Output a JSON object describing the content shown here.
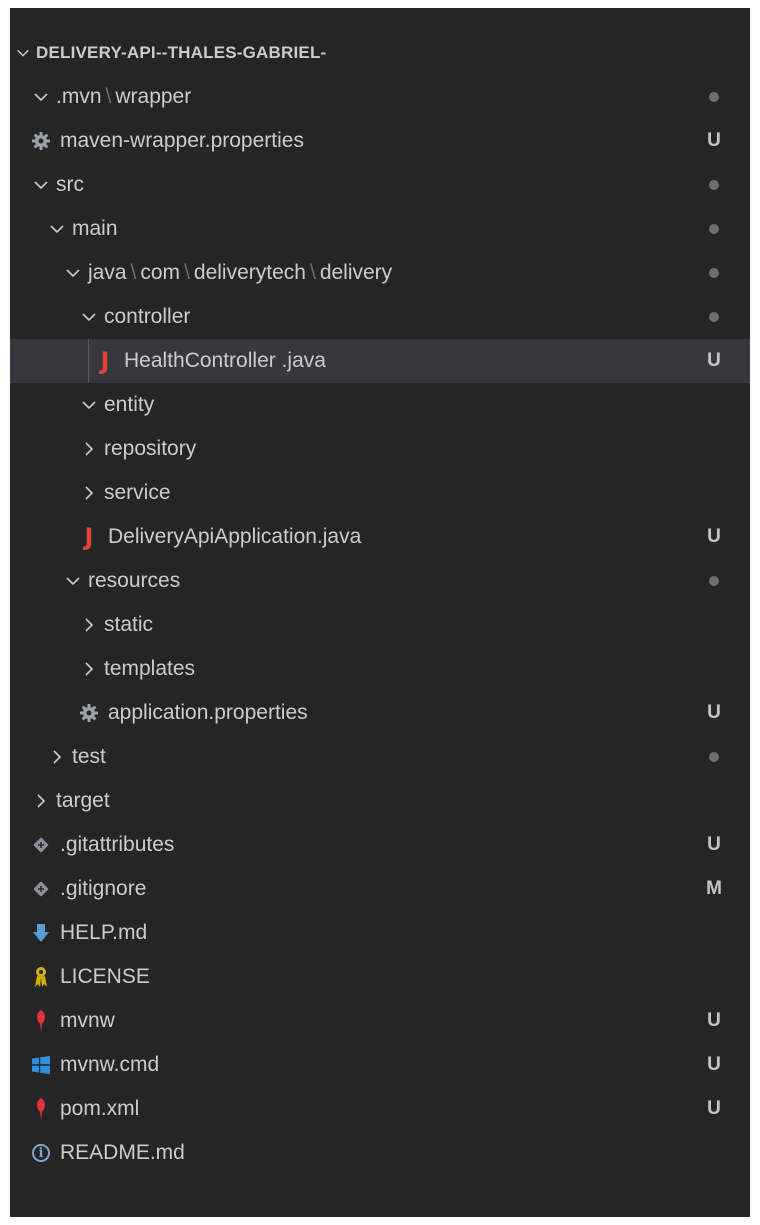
{
  "explorer": {
    "root_label": "DELIVERY-API--THALES-GABRIEL-",
    "items": [
      {
        "type": "folder",
        "expanded": true,
        "depth": 1,
        "segments": [
          ".mvn",
          "wrapper"
        ],
        "badge": "dot"
      },
      {
        "type": "file",
        "depth": 1,
        "icon": "gear-icon",
        "label": "maven-wrapper.properties",
        "badge": "U"
      },
      {
        "type": "folder",
        "expanded": true,
        "depth": 1,
        "segments": [
          "src"
        ],
        "badge": "dot"
      },
      {
        "type": "folder",
        "expanded": true,
        "depth": 2,
        "segments": [
          "main"
        ],
        "badge": "dot"
      },
      {
        "type": "folder",
        "expanded": true,
        "depth": 3,
        "segments": [
          "java",
          "com",
          "deliverytech",
          "delivery"
        ],
        "badge": "dot"
      },
      {
        "type": "folder",
        "expanded": true,
        "depth": 4,
        "segments": [
          "controller"
        ],
        "badge": "dot"
      },
      {
        "type": "file",
        "depth": 5,
        "icon": "java-icon",
        "label": "HealthController .java",
        "badge": "U",
        "selected": true
      },
      {
        "type": "folder",
        "expanded": true,
        "depth": 4,
        "segments": [
          "entity"
        ],
        "badge": ""
      },
      {
        "type": "folder",
        "expanded": false,
        "depth": 4,
        "segments": [
          "repository"
        ],
        "badge": ""
      },
      {
        "type": "folder",
        "expanded": false,
        "depth": 4,
        "segments": [
          "service"
        ],
        "badge": ""
      },
      {
        "type": "file",
        "depth": 4,
        "icon": "java-icon",
        "label": "DeliveryApiApplication.java",
        "badge": "U"
      },
      {
        "type": "folder",
        "expanded": true,
        "depth": 3,
        "segments": [
          "resources"
        ],
        "badge": "dot"
      },
      {
        "type": "folder",
        "expanded": false,
        "depth": 4,
        "segments": [
          "static"
        ],
        "badge": ""
      },
      {
        "type": "folder",
        "expanded": false,
        "depth": 4,
        "segments": [
          "templates"
        ],
        "badge": ""
      },
      {
        "type": "file",
        "depth": 4,
        "icon": "gear-icon",
        "label": "application.properties",
        "badge": "U"
      },
      {
        "type": "folder",
        "expanded": false,
        "depth": 2,
        "segments": [
          "test"
        ],
        "badge": "dot"
      },
      {
        "type": "folder",
        "expanded": false,
        "depth": 1,
        "segments": [
          "target"
        ],
        "badge": ""
      },
      {
        "type": "file",
        "depth": 1,
        "icon": "git-icon",
        "label": ".gitattributes",
        "badge": "U"
      },
      {
        "type": "file",
        "depth": 1,
        "icon": "git-icon",
        "label": ".gitignore",
        "badge": "M"
      },
      {
        "type": "file",
        "depth": 1,
        "icon": "markdown-download-icon",
        "label": "HELP.md",
        "badge": ""
      },
      {
        "type": "file",
        "depth": 1,
        "icon": "license-icon",
        "label": "LICENSE",
        "badge": ""
      },
      {
        "type": "file",
        "depth": 1,
        "icon": "maven-feather-icon",
        "label": "mvnw",
        "badge": "U"
      },
      {
        "type": "file",
        "depth": 1,
        "icon": "windows-icon",
        "label": "mvnw.cmd",
        "badge": "U"
      },
      {
        "type": "file",
        "depth": 1,
        "icon": "maven-feather-icon",
        "label": "pom.xml",
        "badge": "U"
      },
      {
        "type": "file",
        "depth": 1,
        "icon": "info-icon",
        "label": "README.md",
        "badge": ""
      }
    ]
  },
  "colors": {
    "background": "#252526",
    "text": "#cccccc",
    "selected": "#37373d",
    "java": "#e2403d",
    "git": "#8a8f98",
    "markdown": "#5a9bd5",
    "license": "#d4b106",
    "maven": "#e0343c",
    "windows": "#2f8fe0",
    "info": "#7fa7d6"
  }
}
